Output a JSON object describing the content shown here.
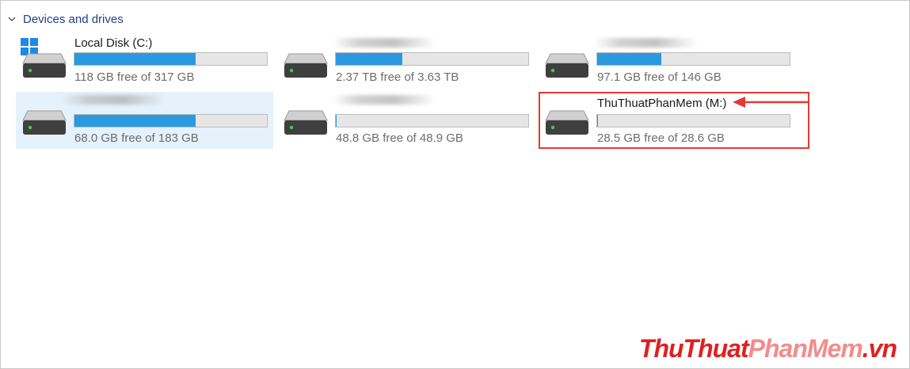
{
  "section": {
    "title": "Devices and drives",
    "chevron_icon": "chevron-down-icon"
  },
  "drives": [
    {
      "name": "Local Disk (C:)",
      "free_text": "118 GB free of 317 GB",
      "used_fraction": 0.628,
      "has_windows_logo": true,
      "name_blurred": false
    },
    {
      "name": "",
      "free_text": "2.37 TB free of 3.63 TB",
      "used_fraction": 0.347,
      "name_blurred": true
    },
    {
      "name": "",
      "free_text": "97.1 GB free of 146 GB",
      "used_fraction": 0.335,
      "name_blurred": true
    },
    {
      "name": "",
      "free_text": "68.0 GB free of 183 GB",
      "used_fraction": 0.628,
      "name_blurred": true,
      "selected": true
    },
    {
      "name": "",
      "free_text": "48.8 GB free of 48.9 GB",
      "used_fraction": 0.002,
      "name_blurred": true
    },
    {
      "name": "ThuThuatPhanMem (M:)",
      "free_text": "28.5 GB free of 28.6 GB",
      "used_fraction": 0.003,
      "name_blurred": false,
      "highlighted": true
    }
  ],
  "colors": {
    "bar_fill": "#2a9ae0",
    "highlight": "#e53935",
    "section_title": "#1f3f8a",
    "selected_bg": "#e5f1fb"
  },
  "watermark": {
    "part1": "ThuThuat",
    "part2": "PhanMem",
    "part3": ".vn"
  }
}
